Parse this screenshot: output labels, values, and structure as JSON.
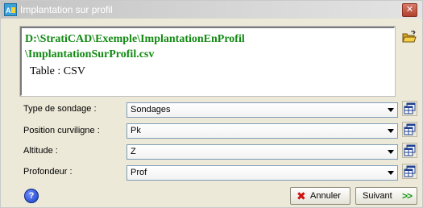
{
  "window": {
    "title": "Implantation sur profil",
    "close_label": "✕"
  },
  "file": {
    "path_line1": "D:\\StratiCAD\\Exemple\\ImplantationEnProfil",
    "path_line2": "\\ImplantationSurProfil.csv",
    "table_info": "Table : CSV"
  },
  "fields": [
    {
      "label": "Type de sondage :",
      "value": "Sondages"
    },
    {
      "label": "Position curviligne :",
      "value": "Pk"
    },
    {
      "label": "Altitude :",
      "value": "Z"
    },
    {
      "label": "Profondeur :",
      "value": "Prof"
    }
  ],
  "buttons": {
    "help": "?",
    "cancel": "Annuler",
    "next": "Suivant",
    "next_chevron": ">>"
  },
  "icons": {
    "app": "straticad-app-icon",
    "folder": "open-folder-icon",
    "table": "table-properties-icon",
    "help": "help-icon",
    "cancel": "red-x-icon",
    "next": "double-chevron-right-icon"
  },
  "colors": {
    "path_text": "#138a13",
    "accent_next": "#149a14",
    "cancel_x": "#d01010"
  }
}
